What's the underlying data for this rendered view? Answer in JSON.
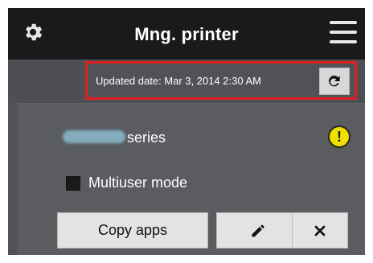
{
  "header": {
    "title": "Mng. printer",
    "left_icon": "gear-icon",
    "right_icon": "menu-icon"
  },
  "update": {
    "text": "Updated date: Mar 3, 2014 2:30 AM",
    "refresh_icon": "refresh-icon"
  },
  "printer": {
    "series_label": "series",
    "warning_icon": "warning-icon",
    "warning_symbol": "!"
  },
  "options": {
    "multiuser_label": "Multiuser mode"
  },
  "actions": {
    "copy_label": "Copy apps",
    "edit_icon": "pencil-icon",
    "remove_icon": "close-icon"
  },
  "colors": {
    "header_bg": "#1a1a1a",
    "page_bg": "#4f5156",
    "card_bg": "#5a5c60",
    "highlight": "#e01e1e",
    "warning": "#f0e000",
    "button_bg": "#e3e3e3"
  }
}
